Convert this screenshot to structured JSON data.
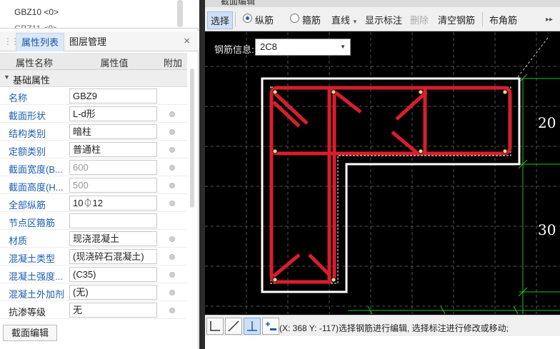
{
  "top_list": {
    "item1": "GBZ10 <0>"
  },
  "tabs": {
    "props": "属性列表",
    "layers": "图层管理",
    "close": "×"
  },
  "grid_header": {
    "name": "属性名称",
    "value": "属性值",
    "extra": "附加"
  },
  "group": {
    "label": "基础属性"
  },
  "properties": [
    {
      "name": "名称",
      "value": "GBZ9"
    },
    {
      "name": "截面形状",
      "value": "L-d形"
    },
    {
      "name": "结构类别",
      "value": "暗柱"
    },
    {
      "name": "定额类别",
      "value": "普通柱"
    },
    {
      "name": "截面宽度(B...",
      "value": "600"
    },
    {
      "name": "截面高度(H...",
      "value": "500"
    },
    {
      "name": "全部纵筋",
      "value": "10⏀12"
    },
    {
      "name": "节点区箍筋",
      "value": ""
    },
    {
      "name": "材质",
      "value": "现浇混凝土"
    },
    {
      "name": "混凝土类型",
      "value": "(现浇碎石混凝土)"
    },
    {
      "name": "混凝土强度...",
      "value": "(C35)"
    },
    {
      "name": "混凝土外加剂",
      "value": "(无)"
    },
    {
      "name": "抗渗等级",
      "value": "无"
    }
  ],
  "buttons": {
    "section_edit": "截面编辑"
  },
  "editor": {
    "title": "截面编辑",
    "toolbar": {
      "select": "选择",
      "longitudinal": "纵筋",
      "stirrup": "箍筋",
      "line": "直线",
      "show_label": "显示标注",
      "delete": "删除",
      "clear": "清空钢筋",
      "corner": "布角筋",
      "more": "▸▸"
    },
    "rebar_info_label": "钢筋信息:",
    "rebar_info_value": "2C8",
    "dims": {
      "d1": "20",
      "d2": "30"
    },
    "status_text": "(X: 368 Y: -117)选择钢筋进行编辑, 选择标注进行修改或移动;"
  },
  "colors": {
    "rebar": "#d81e2c",
    "outline": "#ffffff",
    "grid": "#4a4a4a",
    "dim": "#22c322",
    "accent": "#1a5fb4"
  },
  "icons": [
    "pipe-icon",
    "dot-icon",
    "line-icon",
    "angle-icon",
    "point-icon",
    "add-dim-icon"
  ]
}
